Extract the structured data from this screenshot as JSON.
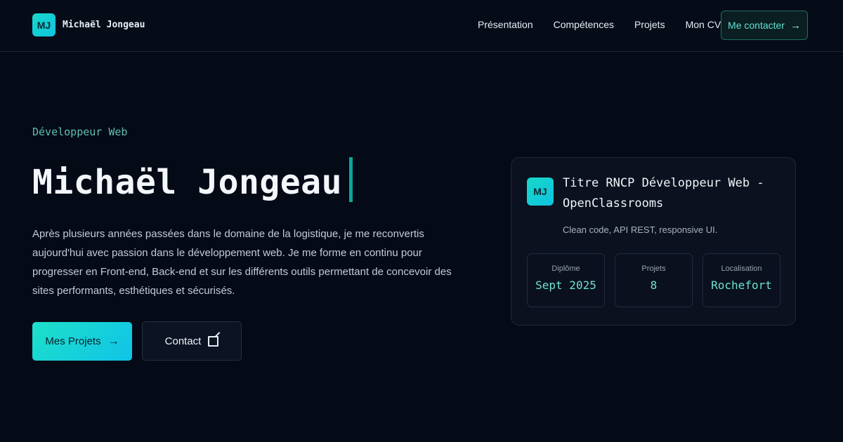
{
  "header": {
    "logo": "MJ",
    "brand_name": "Michaël Jongeau",
    "nav": [
      "Présentation",
      "Compétences",
      "Projets",
      "Mon CV"
    ],
    "cta": "Me contacter",
    "cta_icon": "arrow-right-icon"
  },
  "hero": {
    "eyebrow": "Développeur Web",
    "title": "Michaël Jongeau",
    "description": "Après plusieurs années passées dans le domaine de la logistique, je me reconvertis aujourd'hui avec passion dans le développement web. Je me forme en continu pour progresser en Front-end, Back-end et sur les différents outils permettant de concevoir des sites performants, esthétiques et sécurisés.",
    "primary_button": "Mes Projets",
    "secondary_button": "Contact"
  },
  "card": {
    "logo": "MJ",
    "title": "Titre RNCP Développeur Web - OpenClassrooms",
    "subtitle": "Clean code, API REST, responsive UI.",
    "stats": [
      {
        "label": "Diplôme",
        "value": "Sept 2025"
      },
      {
        "label": "Projets",
        "value": "8"
      },
      {
        "label": "Localisation",
        "value": "Rochefort"
      }
    ]
  },
  "colors": {
    "background": "#050a17",
    "accent": "#1ee0c9",
    "accent_text": "#6ee3cf"
  }
}
